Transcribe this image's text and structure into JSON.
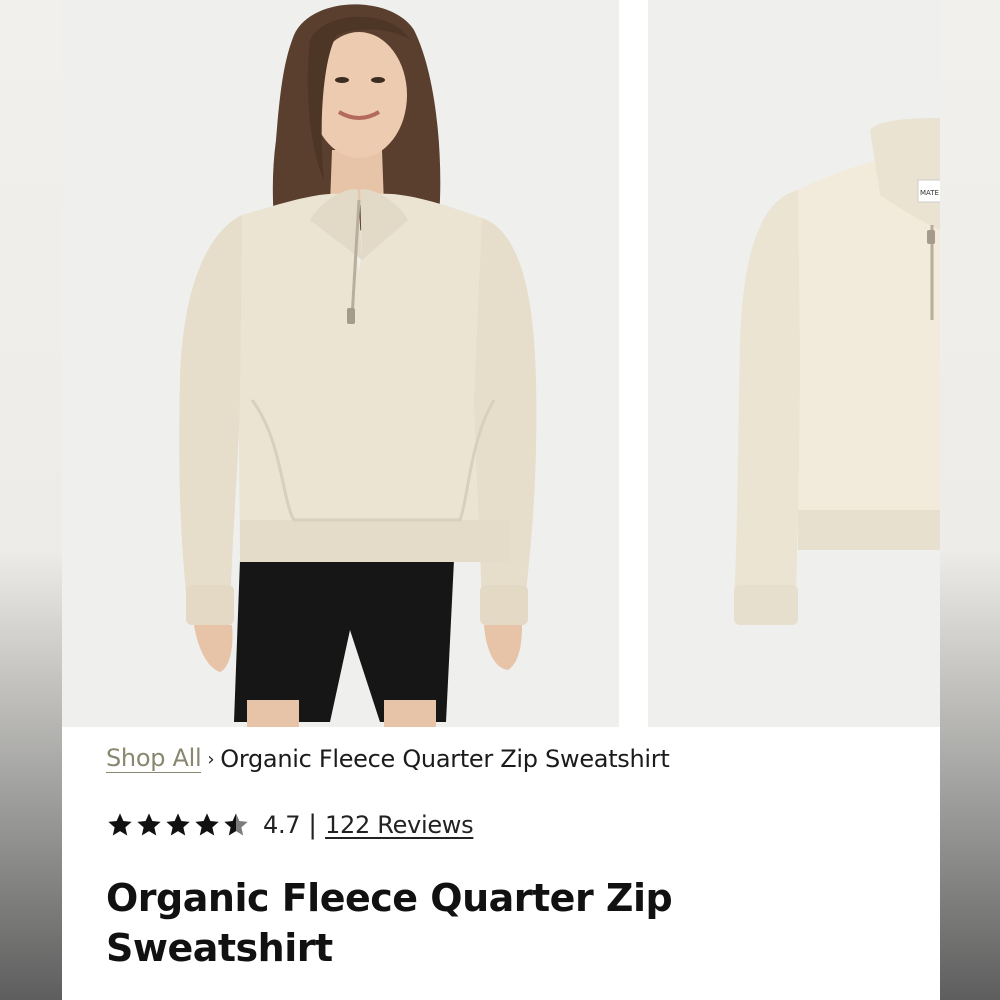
{
  "breadcrumb": {
    "shop_all": "Shop All",
    "separator": "›",
    "current": "Organic Fleece Quarter Zip Sweatshirt"
  },
  "rating": {
    "stars_filled": 4.5,
    "stars_total": 5,
    "value": "4.7",
    "separator": "|",
    "reviews_label": "122 Reviews"
  },
  "product": {
    "title": "Organic Fleece Quarter Zip Sweatshirt"
  },
  "images": {
    "garment_label": "MATE",
    "sweater_color": "#ece4d3",
    "shorts_color": "#161616"
  }
}
